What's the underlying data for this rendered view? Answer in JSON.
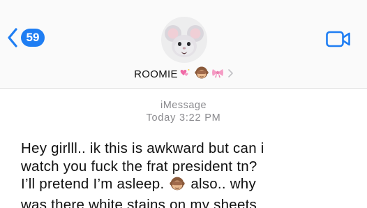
{
  "nav": {
    "back_icon": "chevron-left-icon",
    "unread_count": "59",
    "video_icon": "video-camera-icon",
    "accent_color": "#1f7ef3"
  },
  "contact": {
    "avatar": "mouse-memoji-icon",
    "name": "ROOMIE",
    "name_emojis": [
      "sparkling-heart",
      "see-no-evil-monkey",
      "pink-bow"
    ]
  },
  "thread": {
    "service": "iMessage",
    "timestamp": "Today 3:22 PM"
  },
  "message": {
    "line1": "Hey girlll.. ik this is awkward but can i",
    "line2": "watch you fuck the frat president tn?",
    "line3a": "I’ll pretend I’m asleep.",
    "line3_emoji": "see-no-evil-monkey",
    "line3b": "also.. why",
    "line4": "was there white stains on my sheets"
  }
}
